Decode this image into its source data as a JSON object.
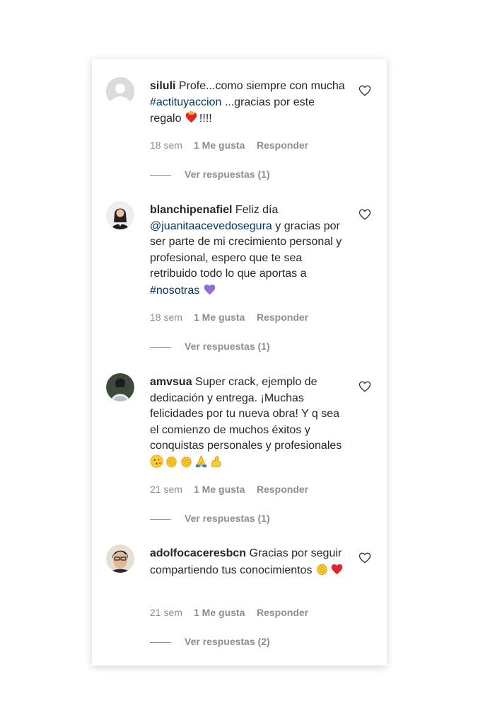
{
  "comments": [
    {
      "username": "siluli",
      "text_parts": [
        "Profe...como siempre con mucha ",
        "#actituyaccion",
        " ...gracias por este regalo ",
        "!!!!"
      ],
      "time": "18 sem",
      "likes": "1 Me gusta",
      "reply": "Responder",
      "view_replies": "Ver respuestas (1)",
      "emojis": [
        "heart-on-fire"
      ]
    },
    {
      "username": "blanchipenafiel",
      "text_parts": [
        " Feliz día ",
        "@juanitaacevedosegura",
        " y gracias por ser parte de mi crecimiento personal y profesional, espero que te sea retribuido todo lo que aportas a ",
        "#nosotras",
        " "
      ],
      "time": "18 sem",
      "likes": "1 Me gusta",
      "reply": "Responder",
      "view_replies": "Ver respuestas (1)",
      "emojis": [
        "purple-heart"
      ]
    },
    {
      "username": "amvsua",
      "text_parts": [
        " Super crack, ejemplo de dedicación y entrega. ¡Muchas felicidades por tu nueva obra! Y q sea el comienzo de muchos éxitos y conquistas personales y profesionales "
      ],
      "time": "21 sem",
      "likes": "1 Me gusta",
      "reply": "Responder",
      "view_replies": "Ver respuestas (1)",
      "emojis": [
        "kissing-face",
        "clapping-hands",
        "clapping-hands",
        "folded-hands",
        "flexed-biceps"
      ]
    },
    {
      "username": "adolfocaceresbcn",
      "text_parts": [
        " Gracias por seguir compartiendo tus conocimientos "
      ],
      "time": "21 sem",
      "likes": "1 Me gusta",
      "reply": "Responder",
      "view_replies": "Ver respuestas (2)",
      "emojis": [
        "clapping-hands",
        "red-heart"
      ]
    }
  ],
  "colors": {
    "text": "#262626",
    "link": "#00376b",
    "muted": "#8e8e8e"
  },
  "icons": {
    "like": "heart-outline-icon"
  }
}
